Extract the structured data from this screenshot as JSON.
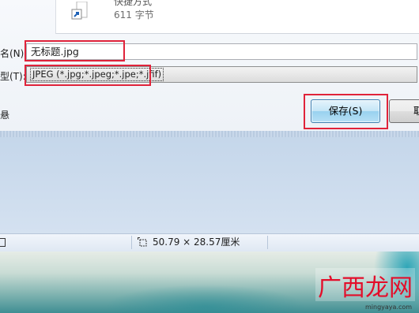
{
  "file_list": {
    "item_name": "快捷方式",
    "item_size": "611 字节"
  },
  "form": {
    "filename_label": "名(N):",
    "filename_value": "无标题.jpg",
    "filetype_label": "型(T):",
    "filetype_value": "JPEG (*.jpg;*.jpeg;*.jpe;*.jfif)",
    "hide_folders_fragment": "悬"
  },
  "buttons": {
    "save_label": "保存(S)",
    "cancel_label": "取"
  },
  "statusbar": {
    "image_size": "50.79 × 28.57厘米"
  },
  "watermark": {
    "logo_text": "广西龙网",
    "url": "mingyaya.com"
  },
  "colors": {
    "highlight": "#e0233a",
    "save_button": "#98d1ef",
    "workspace": "#c4d6ea"
  }
}
